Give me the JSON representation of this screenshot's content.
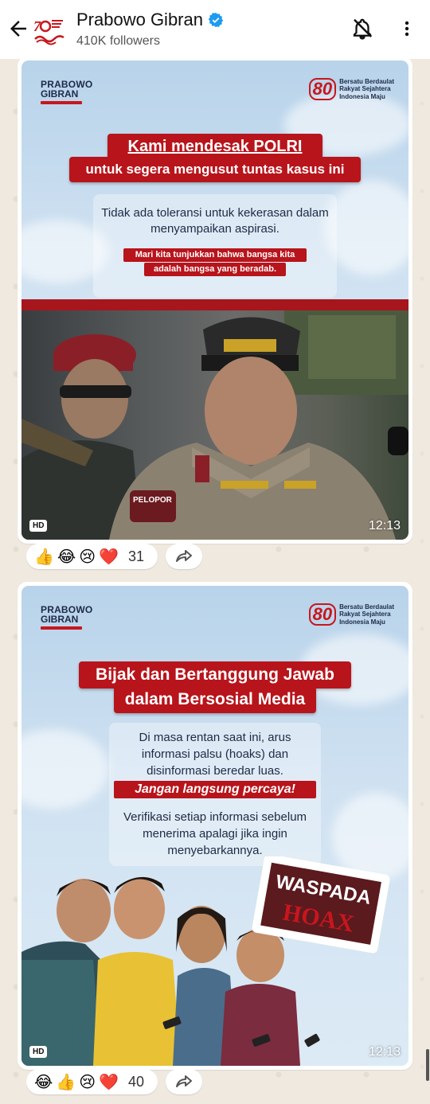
{
  "header": {
    "channel_name": "Prabowo Gibran",
    "followers": "410K followers"
  },
  "posts": [
    {
      "brand_line1": "PRABOWO",
      "brand_line2": "GIBRAN",
      "logo_80": "80",
      "motto": [
        "Bersatu Berdaulat",
        "Rakyat Sejahtera",
        "Indonesia Maju"
      ],
      "title_line1": "Kami mendesak POLRI",
      "title_line2": "untuk segera mengusut tuntas kasus ini",
      "body": "Tidak ada toleransi untuk kekerasan dalam menyampaikan aspirasi.",
      "tag_line1": "Mari kita tunjukkan bahwa bangsa kita",
      "tag_line2": "adalah bangsa yang beradab.",
      "badge_patch": "PELOPOR",
      "hd": "HD",
      "duration": "12:13",
      "reactions": [
        "👍",
        "😂",
        "😢",
        "❤️"
      ],
      "reaction_count": "31"
    },
    {
      "brand_line1": "PRABOWO",
      "brand_line2": "GIBRAN",
      "logo_80": "80",
      "motto": [
        "Bersatu Berdaulat",
        "Rakyat Sejahtera",
        "Indonesia Maju"
      ],
      "title_line1": "Bijak dan Bertanggung Jawab",
      "title_line2": "dalam Bersosial Media",
      "body1": "Di masa rentan saat ini, arus informasi palsu (hoaks) dan disinformasi beredar luas.",
      "tag": "Jangan langsung percaya!",
      "body2": "Verifikasi setiap informasi sebelum menerima apalagi jika ingin menyebarkannya.",
      "stamp_top": "WASPADA",
      "stamp_bottom": "HOAX",
      "hd": "HD",
      "duration": "12:13",
      "reactions": [
        "😂",
        "👍",
        "😢",
        "❤️"
      ],
      "reaction_count": "40"
    }
  ],
  "colors": {
    "accent_red": "#b8141b",
    "verified_blue": "#1d9bf0"
  }
}
